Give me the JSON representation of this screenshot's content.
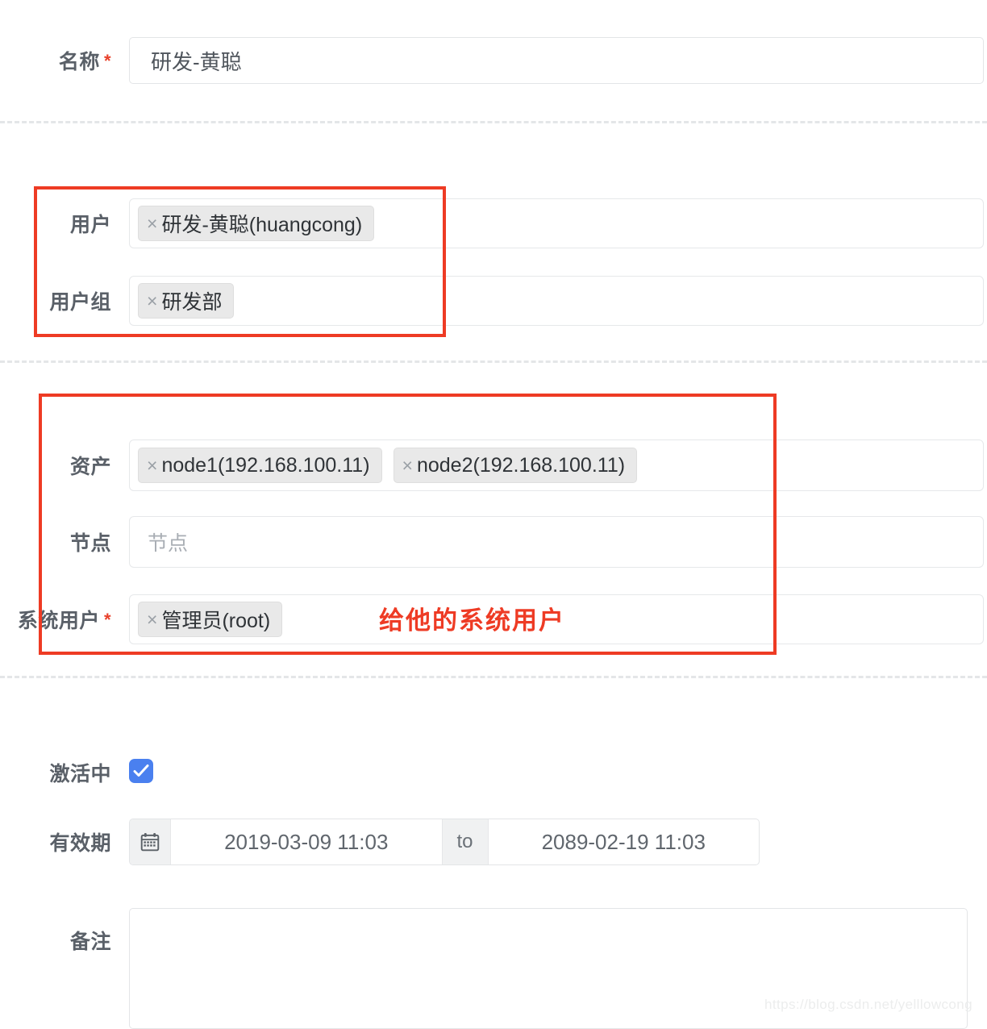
{
  "form": {
    "rows": [
      {
        "label": "名称",
        "required": true,
        "type": "text",
        "value": "研发-黄聪"
      },
      {
        "label": "用户",
        "required": false,
        "type": "tags",
        "tags": [
          "研发-黄聪(huangcong)"
        ]
      },
      {
        "label": "用户组",
        "required": false,
        "type": "tags",
        "tags": [
          "研发部"
        ]
      },
      {
        "label": "资产",
        "required": false,
        "type": "tags",
        "tags": [
          "node1(192.168.100.11)",
          "node2(192.168.100.11)"
        ]
      },
      {
        "label": "节点",
        "required": false,
        "type": "empty-select",
        "placeholder": "节点"
      },
      {
        "label": "系统用户",
        "required": true,
        "type": "tags",
        "tags": [
          "管理员(root)"
        ]
      },
      {
        "label": "激活中",
        "required": false,
        "type": "checkbox",
        "checked": true
      },
      {
        "label": "有效期",
        "required": false,
        "type": "daterange",
        "start": "2019-03-09 11:03",
        "separator": "to",
        "end": "2089-02-19 11:03"
      },
      {
        "label": "备注",
        "required": false,
        "type": "textarea",
        "value": ""
      }
    ],
    "required_marker": "*",
    "tag_remove_glyph": "×"
  },
  "annotations": {
    "color": "#ee3b24",
    "callout_text": "给他的系统用户"
  },
  "watermark": {
    "text": "https://blog.csdn.net/yelllowcong"
  }
}
